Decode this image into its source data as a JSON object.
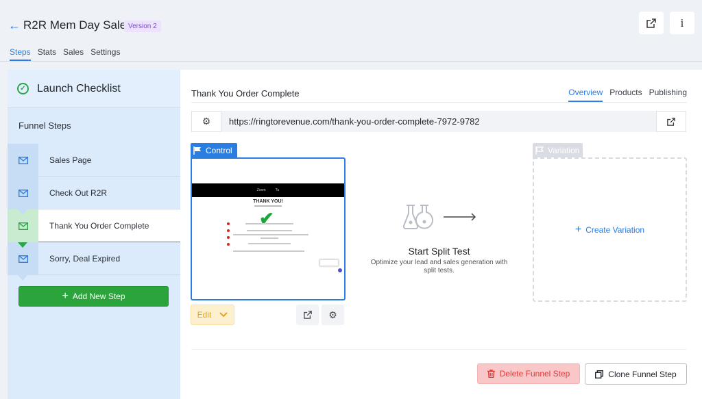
{
  "header": {
    "back_icon": "arrow-left-icon",
    "title": "R2R Mem Day Sale",
    "version": "Version 2",
    "tabs": [
      {
        "label": "Steps",
        "active": true
      },
      {
        "label": "Stats",
        "active": false
      },
      {
        "label": "Sales",
        "active": false
      },
      {
        "label": "Settings",
        "active": false
      }
    ]
  },
  "sidebar": {
    "launch_checklist": "Launch Checklist",
    "funnel_steps_title": "Funnel Steps",
    "steps": [
      {
        "label": "Sales Page",
        "active": false
      },
      {
        "label": "Check Out R2R",
        "active": false
      },
      {
        "label": "Thank You Order Complete",
        "active": true
      },
      {
        "label": "Sorry, Deal Expired",
        "active": false
      }
    ],
    "add_step_label": "Add New Step"
  },
  "main": {
    "title": "Thank You Order Complete",
    "tabs": [
      {
        "label": "Overview",
        "active": true
      },
      {
        "label": "Products",
        "active": false
      },
      {
        "label": "Publishing",
        "active": false
      }
    ],
    "url": "https://ringtorevenue.com/thank-you-order-complete-7972-9782",
    "control_label": "Control",
    "thumbnail": {
      "nav_left": "Zoom",
      "nav_right": "Tu",
      "heading": "THANK YOU!"
    },
    "edit_label": "Edit",
    "split_test_title": "Start Split Test",
    "split_test_desc": "Optimize your lead and sales generation with split tests.",
    "variation_label": "Variation",
    "create_variation_label": "Create Variation",
    "delete_label": "Delete Funnel Step",
    "clone_label": "Clone Funnel Step"
  },
  "colors": {
    "accent": "#2a7de1",
    "success": "#2ca43c",
    "danger": "#e03a3a",
    "warning": "#e0a623"
  }
}
